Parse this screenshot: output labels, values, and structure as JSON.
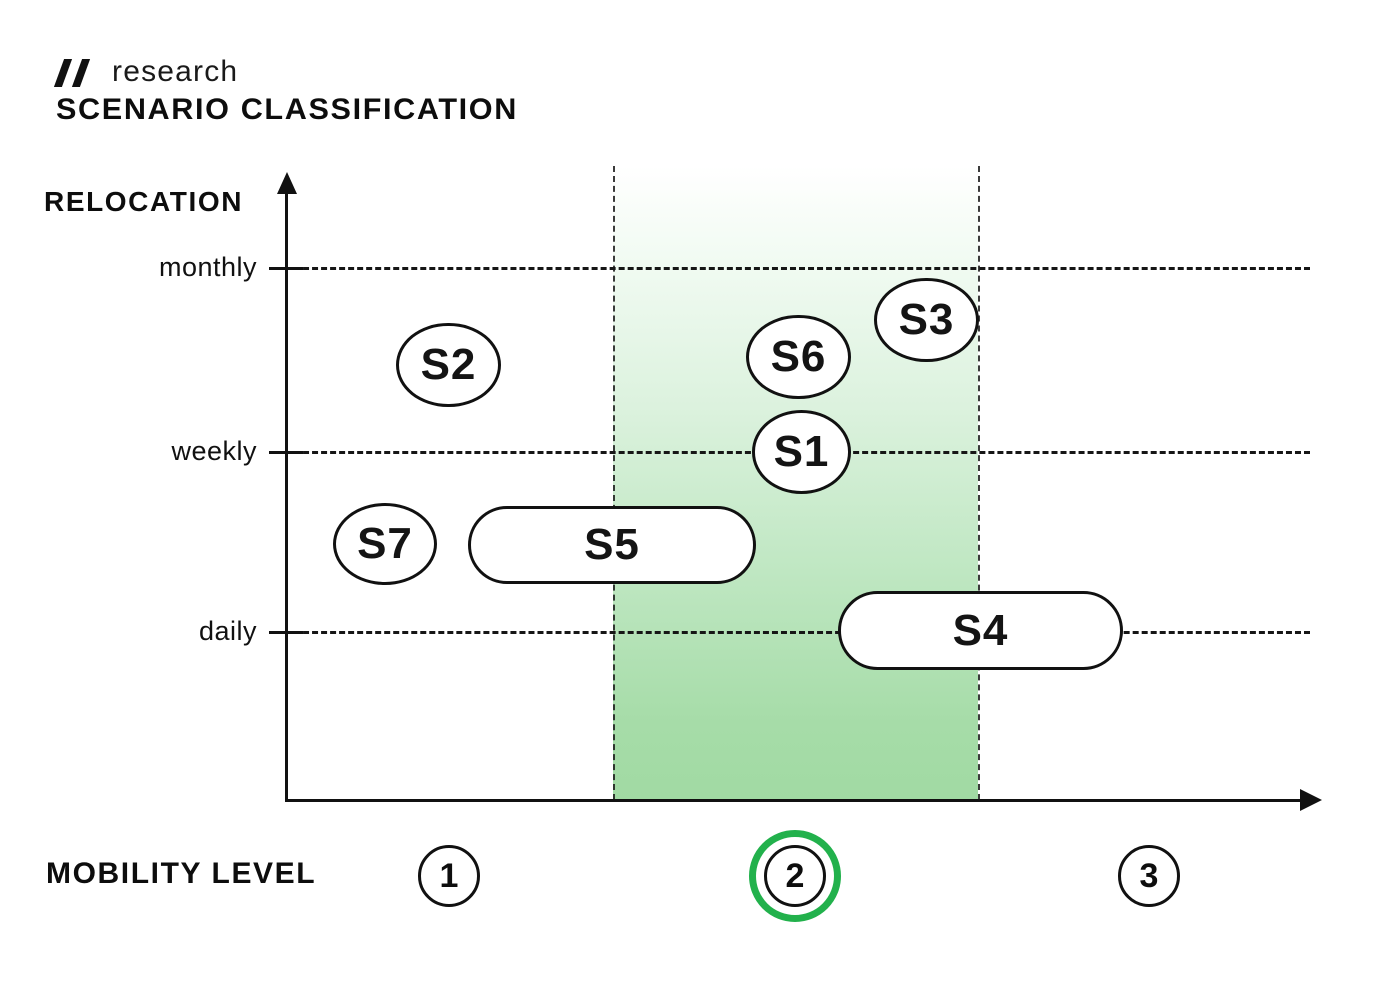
{
  "header": {
    "brand": "research",
    "title": "SCENARIO CLASSIFICATION",
    "slash_icon": "double-slash-icon"
  },
  "axes": {
    "y_title": "RELOCATION",
    "x_title": "MOBILITY LEVEL",
    "y_ticks": [
      "monthly",
      "weekly",
      "daily"
    ]
  },
  "levels": [
    {
      "label": "1",
      "highlighted": false
    },
    {
      "label": "2",
      "highlighted": true
    },
    {
      "label": "3",
      "highlighted": false
    }
  ],
  "scenarios": [
    {
      "label": "S2"
    },
    {
      "label": "S3"
    },
    {
      "label": "S6"
    },
    {
      "label": "S1"
    },
    {
      "label": "S7"
    },
    {
      "label": "S5"
    },
    {
      "label": "S4"
    }
  ],
  "colors": {
    "accent_green": "#22b14c",
    "band_green": "#a1daa3",
    "ink": "#111111",
    "background": "#ffffff"
  },
  "chart_data": {
    "type": "scatter",
    "title": "SCENARIO CLASSIFICATION",
    "xlabel": "MOBILITY LEVEL",
    "ylabel": "RELOCATION",
    "x_categories": [
      "1",
      "2",
      "3"
    ],
    "y_tick_labels": [
      "daily",
      "weekly",
      "monthly"
    ],
    "grid": true,
    "legend": "none",
    "highlight_band": {
      "axis": "x",
      "from": 1.5,
      "to": 2.5,
      "fill": "vertical gradient white to green",
      "color": "#a1daa3"
    },
    "highlighted_category": "2",
    "points": [
      {
        "label": "S2",
        "x": 1.1,
        "y": "between weekly and monthly",
        "shape": "ellipse",
        "x_span": 0.22
      },
      {
        "label": "S3",
        "x": 2.35,
        "y": "just below monthly",
        "shape": "ellipse",
        "x_span": 0.22
      },
      {
        "label": "S6",
        "x": 2.0,
        "y": "between weekly and monthly",
        "shape": "ellipse",
        "x_span": 0.22
      },
      {
        "label": "S1",
        "x": 2.05,
        "y": "weekly",
        "shape": "ellipse",
        "x_span": 0.22
      },
      {
        "label": "S7",
        "x": 0.85,
        "y": "between daily and weekly",
        "shape": "ellipse",
        "x_span": 0.22
      },
      {
        "label": "S5",
        "x": 1.45,
        "y": "between daily and weekly",
        "shape": "pill",
        "x_span": 0.8
      },
      {
        "label": "S4",
        "x": 2.55,
        "y": "daily",
        "shape": "pill",
        "x_span": 0.8
      }
    ]
  }
}
